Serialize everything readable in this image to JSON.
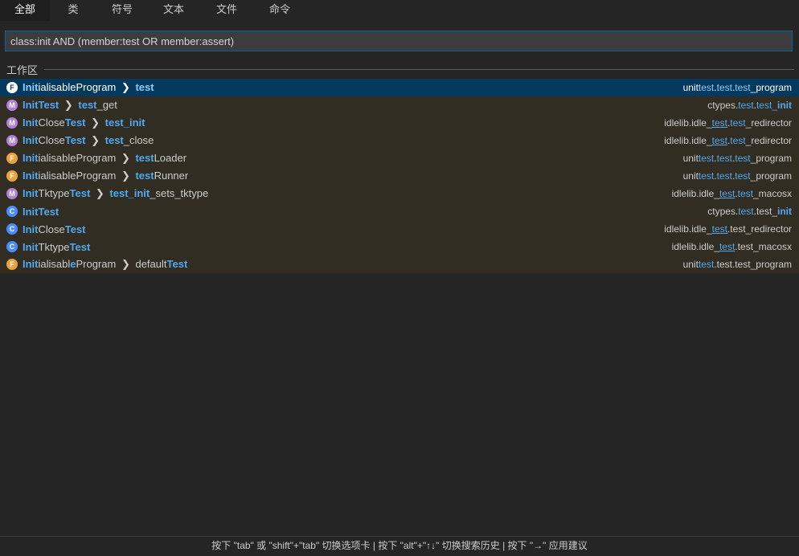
{
  "tabs": [
    {
      "label": "全部",
      "active": true
    },
    {
      "label": "类",
      "active": false
    },
    {
      "label": "符号",
      "active": false
    },
    {
      "label": "文本",
      "active": false
    },
    {
      "label": "文件",
      "active": false
    },
    {
      "label": "命令",
      "active": false
    }
  ],
  "search": {
    "value": "class:init AND (member:test OR member:assert)",
    "placeholder": ""
  },
  "section": {
    "label": "工作区"
  },
  "results": [
    {
      "kind": "F",
      "icon": "function-icon",
      "selected": true,
      "name": [
        [
          "Init",
          true
        ],
        [
          "ialisableProgram",
          false
        ],
        [
          " ❯ ",
          "chev"
        ],
        [
          "test",
          true
        ]
      ],
      "path": [
        [
          "unit",
          false
        ],
        [
          "test",
          "hl"
        ],
        [
          ".",
          false
        ],
        [
          "test",
          "hl"
        ],
        [
          ".",
          false
        ],
        [
          "test",
          "hl"
        ],
        [
          "_program",
          false
        ]
      ]
    },
    {
      "kind": "M",
      "icon": "method-icon",
      "selected": false,
      "name": [
        [
          "InitTest",
          true
        ],
        [
          " ❯ ",
          "chev"
        ],
        [
          "test",
          true
        ],
        [
          "_get",
          false
        ]
      ],
      "path": [
        [
          "ctypes.",
          false
        ],
        [
          "test",
          "hl"
        ],
        [
          ".",
          false
        ],
        [
          "test",
          "hl"
        ],
        [
          "_",
          "hl"
        ],
        [
          "init",
          "hlb"
        ]
      ]
    },
    {
      "kind": "M",
      "icon": "method-icon",
      "selected": false,
      "name": [
        [
          "Init",
          true
        ],
        [
          "Close",
          false
        ],
        [
          "Test",
          true
        ],
        [
          " ❯ ",
          "chev"
        ],
        [
          "test_init",
          true
        ]
      ],
      "path": [
        [
          "idlelib.idle_",
          false
        ],
        [
          "test",
          "hlu"
        ],
        [
          ".",
          false
        ],
        [
          "test",
          "hl"
        ],
        [
          "_redirector",
          false
        ]
      ]
    },
    {
      "kind": "M",
      "icon": "method-icon",
      "selected": false,
      "name": [
        [
          "Init",
          true
        ],
        [
          "Close",
          false
        ],
        [
          "Test",
          true
        ],
        [
          " ❯ ",
          "chev"
        ],
        [
          "test",
          true
        ],
        [
          "_close",
          false
        ]
      ],
      "path": [
        [
          "idlelib.idle_",
          false
        ],
        [
          "test",
          "hlu"
        ],
        [
          ".",
          false
        ],
        [
          "test",
          "hl"
        ],
        [
          "_redirector",
          false
        ]
      ]
    },
    {
      "kind": "F",
      "icon": "function-icon",
      "selected": false,
      "name": [
        [
          "Init",
          true
        ],
        [
          "ialisableProgram",
          false
        ],
        [
          " ❯ ",
          "chev"
        ],
        [
          "test",
          true
        ],
        [
          "Loader",
          false
        ]
      ],
      "path": [
        [
          "unit",
          false
        ],
        [
          "test",
          "hl"
        ],
        [
          ".",
          false
        ],
        [
          "test",
          "hl"
        ],
        [
          ".",
          false
        ],
        [
          "test",
          "hl"
        ],
        [
          "_program",
          false
        ]
      ]
    },
    {
      "kind": "F",
      "icon": "function-icon",
      "selected": false,
      "name": [
        [
          "Init",
          true
        ],
        [
          "ialisableProgram",
          false
        ],
        [
          " ❯ ",
          "chev"
        ],
        [
          "test",
          true
        ],
        [
          "Runner",
          false
        ]
      ],
      "path": [
        [
          "unit",
          false
        ],
        [
          "test",
          "hl"
        ],
        [
          ".",
          false
        ],
        [
          "test",
          "hl"
        ],
        [
          ".",
          false
        ],
        [
          "test",
          "hl"
        ],
        [
          "_program",
          false
        ]
      ]
    },
    {
      "kind": "M",
      "icon": "method-icon",
      "selected": false,
      "name": [
        [
          "Init",
          true
        ],
        [
          "Tktype",
          false
        ],
        [
          "Test",
          true
        ],
        [
          " ❯ ",
          "chev"
        ],
        [
          "test_init",
          true
        ],
        [
          "_sets_tktype",
          false
        ]
      ],
      "path": [
        [
          "idlelib.idle_",
          false
        ],
        [
          "test",
          "hlu"
        ],
        [
          ".",
          false
        ],
        [
          "test",
          "hl"
        ],
        [
          "_macosx",
          false
        ]
      ]
    },
    {
      "kind": "C",
      "icon": "class-icon",
      "selected": false,
      "name": [
        [
          "InitTest",
          true
        ]
      ],
      "path": [
        [
          "ctypes.",
          false
        ],
        [
          "test",
          "hl"
        ],
        [
          ".test_",
          false
        ],
        [
          "init",
          "hlb"
        ]
      ]
    },
    {
      "kind": "C",
      "icon": "class-icon",
      "selected": false,
      "name": [
        [
          "Init",
          true
        ],
        [
          "Close",
          false
        ],
        [
          "Test",
          true
        ]
      ],
      "path": [
        [
          "idlelib.idle_",
          false
        ],
        [
          "test",
          "hlu"
        ],
        [
          ".test_redirector",
          false
        ]
      ]
    },
    {
      "kind": "C",
      "icon": "class-icon",
      "selected": false,
      "name": [
        [
          "Init",
          true
        ],
        [
          "Tktype",
          false
        ],
        [
          "Test",
          true
        ]
      ],
      "path": [
        [
          "idlelib.idle_",
          false
        ],
        [
          "test",
          "hlu"
        ],
        [
          ".test_macosx",
          false
        ]
      ]
    },
    {
      "kind": "F",
      "icon": "function-icon",
      "selected": false,
      "name": [
        [
          "Init",
          true
        ],
        [
          "ialisabl",
          false
        ],
        [
          "e",
          true
        ],
        [
          "Program",
          false
        ],
        [
          " ❯ ",
          "chev"
        ],
        [
          "default",
          false
        ],
        [
          "Test",
          true
        ]
      ],
      "path": [
        [
          "unit",
          false
        ],
        [
          "test",
          "hl"
        ],
        [
          ".test.test_program",
          false
        ]
      ]
    }
  ],
  "status": {
    "hint": "按下 \"tab\" 或 \"shift\"+\"tab\" 切换选项卡 | 按下 \"alt\"+\"↑↓\" 切换搜索历史 | 按下 \"→\" 应用建议"
  },
  "colors": {
    "background": "#252526",
    "selected_row": "#04395e",
    "result_row": "#312d23",
    "highlight": "#4fa8f0",
    "input_border": "#0e639c"
  }
}
